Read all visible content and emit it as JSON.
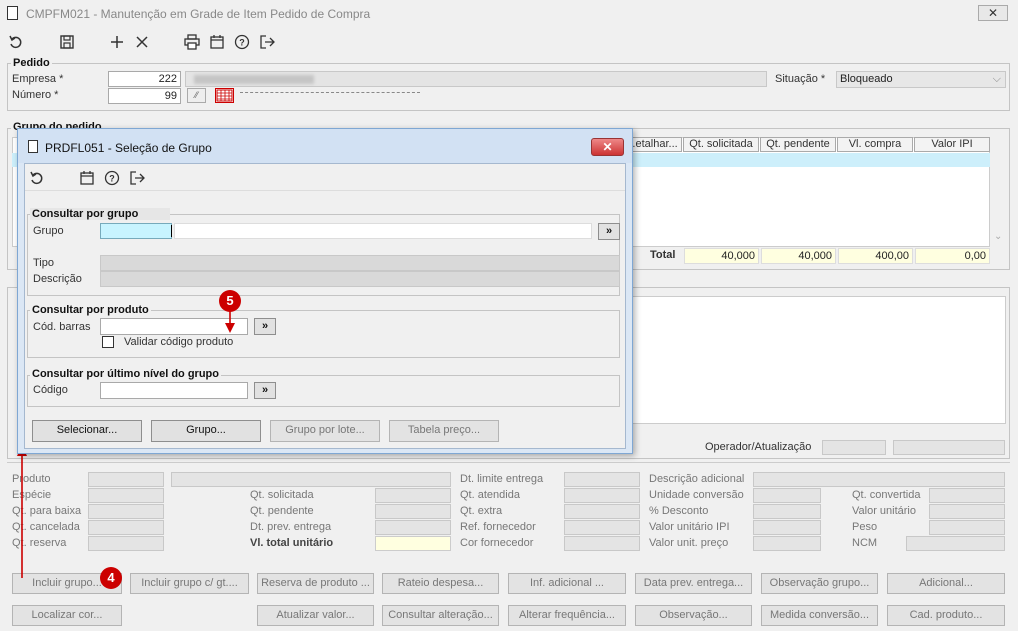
{
  "window": {
    "title": "CMPFM021 - Manutenção em Grade de Item Pedido de Compra"
  },
  "pedido": {
    "section": "Pedido",
    "empresa_label": "Empresa *",
    "empresa_value": "222",
    "numero_label": "Número *",
    "numero_value": "99",
    "situacao_label": "Situação *",
    "situacao_value": "Bloqueado"
  },
  "grupo_pedido": {
    "section": "Grupo do pedido"
  },
  "grid": {
    "headers": [
      "...etalhar...",
      "Qt. solicitada",
      "Qt. pendente",
      "Vl. compra",
      "Valor IPI"
    ],
    "total_label": "Total",
    "totals": [
      "40,000",
      "40,000",
      "400,00",
      "0,00"
    ]
  },
  "operador_label": "Operador/Atualização",
  "detail": {
    "col1": [
      "Produto",
      "Espécie",
      "Qt. para baixa",
      "Qt. cancelada",
      "Qt. reserva"
    ],
    "col2": [
      "Qt. solicitada",
      "Qt. pendente",
      "Dt. prev. entrega",
      "Vl. total unitário"
    ],
    "col3": [
      "Dt. limite entrega",
      "Qt. atendida",
      "Qt. extra",
      "Ref. fornecedor",
      "Cor fornecedor"
    ],
    "col4": [
      "Descrição adicional",
      "Unidade conversão",
      "% Desconto",
      "Valor unitário IPI",
      "Valor unit. preço"
    ],
    "col5": [
      "Qt. convertida",
      "Valor unitário",
      "Peso",
      "NCM"
    ]
  },
  "bottom_buttons_row1": [
    "Incluir grupo...",
    "Incluir grupo c/ gt....",
    "Reserva de produto ...",
    "Rateio despesa...",
    "Inf. adicional ...",
    "Data prev. entrega...",
    "Observação grupo...",
    "Adicional..."
  ],
  "bottom_buttons_row2": [
    "Localizar cor...",
    "Atualizar valor...",
    "Consultar alteração...",
    "Alterar frequência...",
    "Observação...",
    "Medida conversão...",
    "Cad. produto..."
  ],
  "dialog": {
    "title": "PRDFL051 - Seleção de Grupo",
    "sec1": "Consultar por grupo",
    "grupo_label": "Grupo",
    "tipo_label": "Tipo",
    "descricao_label": "Descrição",
    "sec2": "Consultar por produto",
    "cod_barras_label": "Cód. barras",
    "validar_label": "Validar código produto",
    "sec3": "Consultar por último nível do grupo",
    "codigo_label": "Código",
    "lookup_glyph": "»",
    "buttons": [
      "Selecionar...",
      "Grupo...",
      "Grupo por lote...",
      "Tabela preço..."
    ]
  },
  "callouts": {
    "step4": "4",
    "step5": "5"
  },
  "colors": {
    "accent_red": "#cc0000",
    "dialog_border": "#7fa7d3",
    "highlight": "#cdeffb"
  }
}
